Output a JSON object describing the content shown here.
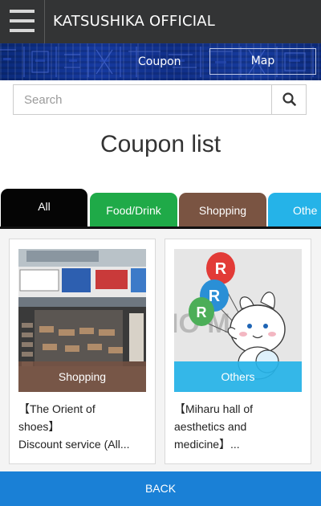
{
  "header": {
    "title": "KATSUSHIKA OFFICIAL",
    "menu_icon": "hamburger-menu-icon"
  },
  "nav": {
    "coupon_label": "Coupon",
    "map_label": "Map"
  },
  "search": {
    "placeholder": "Search",
    "value": "",
    "icon": "search-icon"
  },
  "page": {
    "title": "Coupon list"
  },
  "tabs": [
    {
      "label": "All",
      "color": "#050505",
      "selected": true
    },
    {
      "label": "Food/Drink",
      "color": "#1faa48",
      "selected": false
    },
    {
      "label": "Shopping",
      "color": "#7a5442",
      "selected": false
    },
    {
      "label": "Othe",
      "color": "#25b3e8",
      "selected": false
    }
  ],
  "coupons": [
    {
      "category": "Shopping",
      "category_color": "#765242",
      "title_line1": "【The Orient of",
      "title_line2": "shoes】",
      "title_line3": "Discount service (All..."
    },
    {
      "category": "Others",
      "category_color": "#25b3e8",
      "title_line1": "【Miharu hall of",
      "title_line2": "aesthetics and",
      "title_line3": "medicine】...",
      "image_text": "IO MAGI"
    }
  ],
  "footer": {
    "back_label": "BACK"
  },
  "colors": {
    "topbar": "#333435",
    "banner": "#0a2a7a",
    "back": "#1a80d6"
  }
}
